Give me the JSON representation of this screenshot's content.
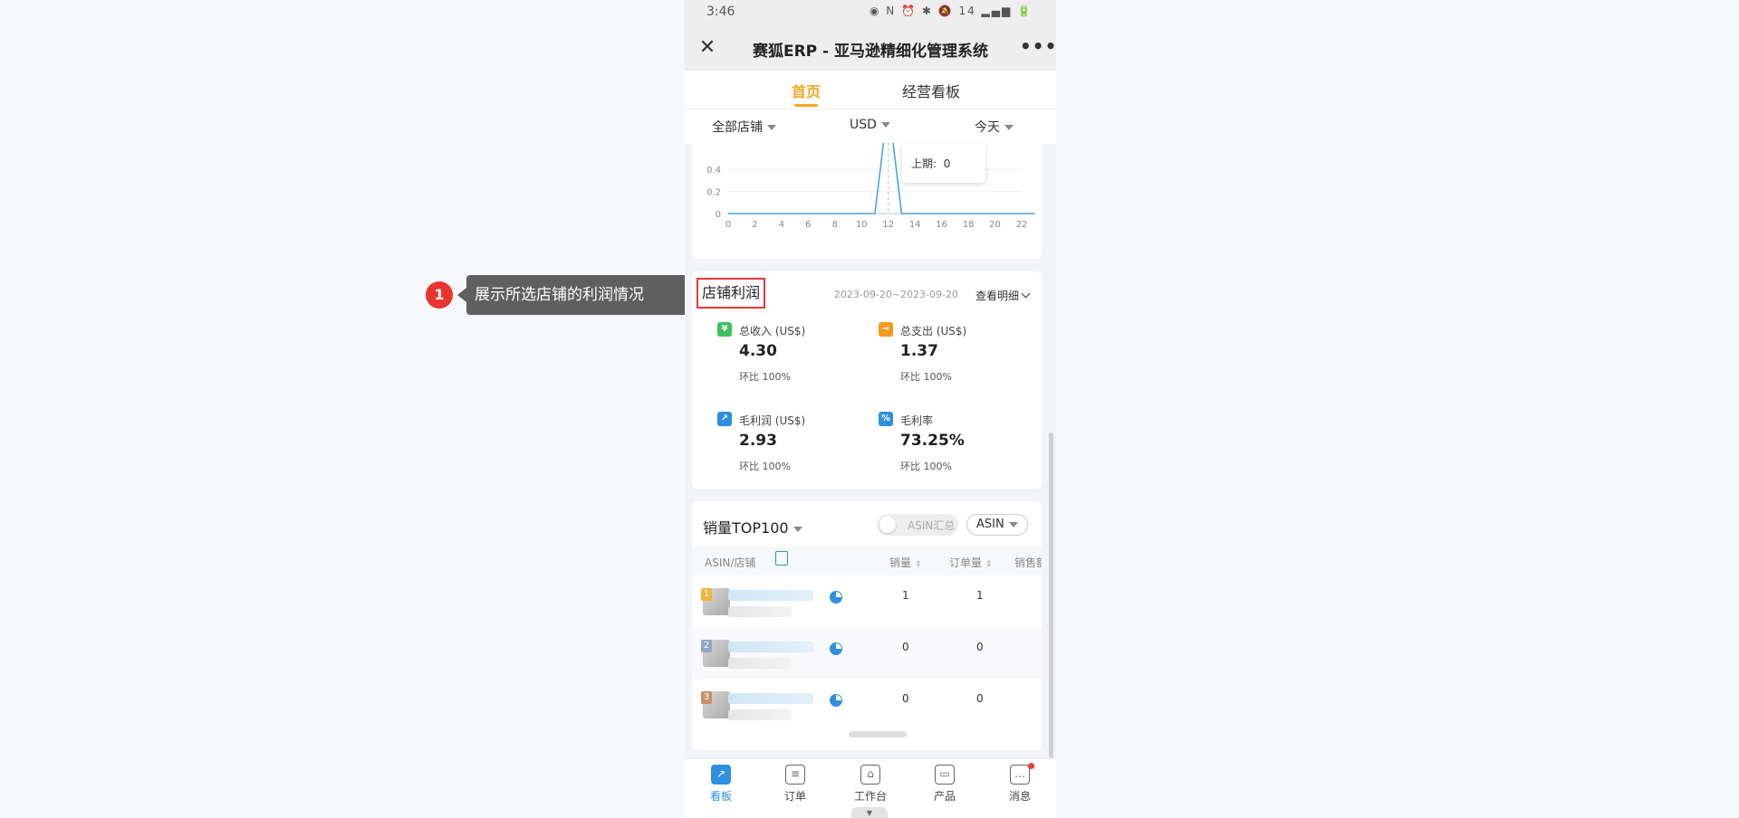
{
  "status_bar": {
    "time": "3:46",
    "icons": "◉ N ⏰ ✱ 🔕 14 ▂▄▆ 🔋"
  },
  "header": {
    "close_glyph": "✕",
    "title": "赛狐ERP - 亚马逊精细化管理系统",
    "more_glyph": "•••"
  },
  "tabs": [
    {
      "label": "首页",
      "active": true
    },
    {
      "label": "经营看板",
      "active": false
    }
  ],
  "filters": {
    "store": "全部店铺",
    "currency": "USD",
    "period": "今天"
  },
  "chart_data": {
    "type": "line",
    "x": [
      0,
      1,
      2,
      3,
      4,
      5,
      6,
      7,
      8,
      9,
      10,
      11,
      12,
      13,
      14,
      15,
      16,
      17,
      18,
      19,
      20,
      21,
      22,
      23
    ],
    "series": [
      {
        "values": [
          0,
          0,
          0,
          0,
          0,
          0,
          0,
          0,
          0,
          0,
          0,
          0,
          1,
          0,
          0,
          0,
          0,
          0,
          0,
          0,
          0,
          0,
          0,
          0
        ]
      }
    ],
    "xticks": [
      "0",
      "2",
      "4",
      "6",
      "8",
      "10",
      "12",
      "14",
      "16",
      "18",
      "20",
      "22"
    ],
    "yticks": [
      "0",
      "0.2",
      "0.4"
    ],
    "ylim": [
      0,
      1
    ],
    "tooltip": {
      "prev_label": "上期:",
      "prev_value": "0"
    }
  },
  "profit": {
    "title": "店铺利润",
    "date_range": "2023-09-20~2023-09-20",
    "detail_label": "查看明细",
    "ratio_label": "环比",
    "metrics": [
      {
        "label": "总收入 (US$)",
        "value": "4.30",
        "ratio": "100%",
        "icon": "revenue-icon",
        "color": "#3fbf5b",
        "glyph": "¥"
      },
      {
        "label": "总支出 (US$)",
        "value": "1.37",
        "ratio": "100%",
        "icon": "expense-icon",
        "color": "#f39a1c",
        "glyph": "→"
      },
      {
        "label": "毛利润 (US$)",
        "value": "2.93",
        "ratio": "100%",
        "icon": "profit-trend-icon",
        "color": "#2f8fe0",
        "glyph": "↗"
      },
      {
        "label": "毛利率",
        "value": "73.25%",
        "ratio": "100%",
        "icon": "percent-icon",
        "color": "#2f8fe0",
        "glyph": "%"
      }
    ]
  },
  "top100": {
    "title": "销量TOP100",
    "toggle_label": "ASIN汇总",
    "select_value": "ASIN",
    "columns": {
      "asin": "ASIN/店铺",
      "sales": "销量",
      "orders": "订单量",
      "amount": "销售额"
    },
    "sort_glyph": "⇕",
    "rows": [
      {
        "rank": "1",
        "sales": "1",
        "orders": "1",
        "rank_color": "#f3b33d"
      },
      {
        "rank": "2",
        "sales": "0",
        "orders": "0",
        "rank_color": "#8ea6c9"
      },
      {
        "rank": "3",
        "sales": "0",
        "orders": "0",
        "rank_color": "#c9906a"
      }
    ]
  },
  "bottom_nav": [
    {
      "label": "看板",
      "glyph": "↗",
      "active": true
    },
    {
      "label": "订单",
      "glyph": "≡",
      "active": false
    },
    {
      "label": "工作台",
      "glyph": "⌂",
      "active": false
    },
    {
      "label": "产品",
      "glyph": "▭",
      "active": false
    },
    {
      "label": "消息",
      "glyph": "…",
      "active": false
    }
  ],
  "handle_glyph": "▼",
  "callout": {
    "number": "1",
    "text": "展示所选店铺的利润情况"
  }
}
